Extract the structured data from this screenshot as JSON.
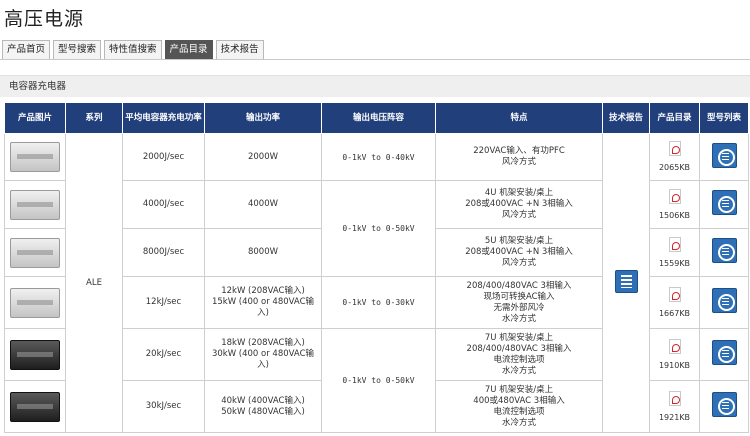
{
  "page": {
    "title": "高压电源"
  },
  "tabs": [
    {
      "label": "产品首页",
      "active": false
    },
    {
      "label": "型号搜索",
      "active": false
    },
    {
      "label": "特性值搜索",
      "active": false
    },
    {
      "label": "产品目录",
      "active": true
    },
    {
      "label": "技术报告",
      "active": false
    }
  ],
  "section": {
    "title": "电容器充电器"
  },
  "table": {
    "headers": {
      "photo": "产品图片",
      "series": "系列",
      "avg_power": "平均电容器充电功率",
      "output_power": "输出功率",
      "voltage": "输出电压阵容",
      "features": "特点",
      "tech_report": "技术报告",
      "catalog": "产品目录",
      "model_list": "型号列表"
    },
    "series": "ALE",
    "voltage_groups": [
      "0-1kV to 0-40kV",
      "0-1kV to 0-50kV",
      "0-1kV to 0-30kV",
      "0-1kV to 0-50kV"
    ],
    "feature_groups": [
      [
        "220VAC输入、有功PFC",
        "风冷方式"
      ],
      [
        "4U 机架安装/桌上",
        "208或400VAC +N 3相输入",
        "风冷方式"
      ],
      [
        "5U 机架安装/桌上",
        "208或400VAC +N 3相输入",
        "风冷方式"
      ],
      [
        "208/400/480VAC 3相输入",
        "现场可转换AC输入",
        "无需外部风冷",
        "水冷方式"
      ],
      [
        "7U 机架安装/桌上",
        "208/400/480VAC 3相输入",
        "电流控制选项",
        "水冷方式"
      ],
      [
        "7U 机架安装/桌上",
        "400或480VAC 3相输入",
        "电流控制选项",
        "水冷方式"
      ]
    ],
    "rows": [
      {
        "avg": "2000J/sec",
        "power": [
          "2000W"
        ],
        "pdf_size": "2065KB",
        "photo": "silver"
      },
      {
        "avg": "4000J/sec",
        "power": [
          "4000W"
        ],
        "pdf_size": "1506KB",
        "photo": "silver"
      },
      {
        "avg": "8000J/sec",
        "power": [
          "8000W"
        ],
        "pdf_size": "1559KB",
        "photo": "silver"
      },
      {
        "avg": "12kJ/sec",
        "power": [
          "12kW (208VAC输入)",
          "15kW (400 or 480VAC输入)"
        ],
        "pdf_size": "1667KB",
        "photo": "silver"
      },
      {
        "avg": "20kJ/sec",
        "power": [
          "18kW (208VAC输入)",
          "30kW (400 or 480VAC输入)"
        ],
        "pdf_size": "1910KB",
        "photo": "black"
      },
      {
        "avg": "30kJ/sec",
        "power": [
          "40kW (400VAC输入)",
          "50kW (480VAC输入)"
        ],
        "pdf_size": "1921KB",
        "photo": "black"
      }
    ]
  },
  "icons": {
    "pdf": "pdf-icon",
    "tech_report": "document-icon",
    "model_list": "model-list-icon",
    "product_photo": "product-photo-icon"
  }
}
